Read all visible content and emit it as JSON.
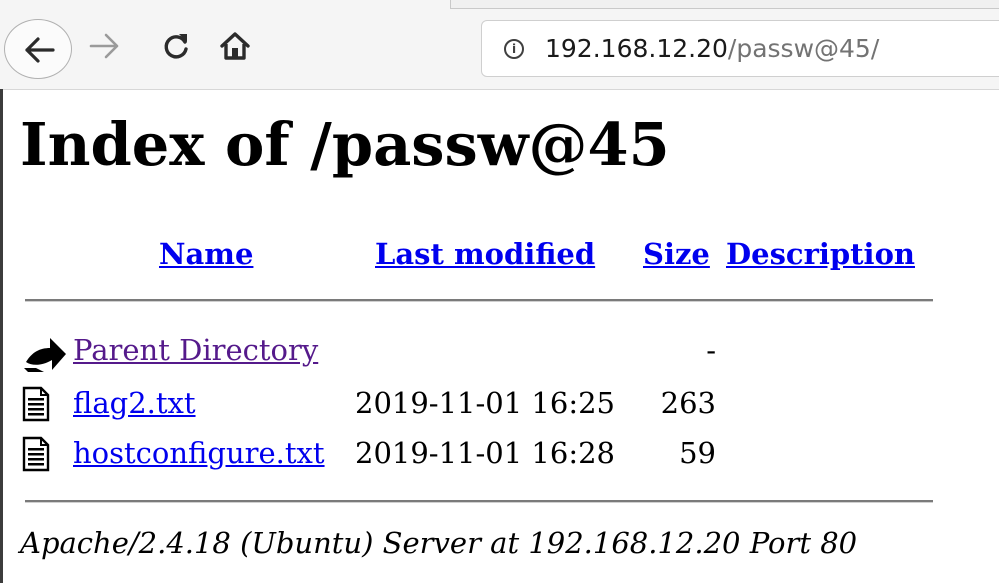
{
  "browser": {
    "url_host": "192.168.12.20",
    "url_path": "/passw@45/",
    "info_icon": "i"
  },
  "page": {
    "title": "Index of /passw@45",
    "columns": {
      "name": "Name",
      "last_modified": "Last modified",
      "size": "Size",
      "description": "Description"
    },
    "rows": [
      {
        "icon": "back-icon",
        "name": "Parent Directory",
        "modified": "",
        "size": "-",
        "description": ""
      },
      {
        "icon": "text-file-icon",
        "name": "flag2.txt",
        "modified": "2019-11-01 16:25",
        "size": "263",
        "description": ""
      },
      {
        "icon": "text-file-icon",
        "name": "hostconfigure.txt",
        "modified": "2019-11-01 16:28",
        "size": "59",
        "description": ""
      }
    ],
    "footer": "Apache/2.4.18 (Ubuntu) Server at 192.168.12.20 Port 80"
  },
  "colors": {
    "link": "#0000ee",
    "visited_link": "#551a8b"
  }
}
